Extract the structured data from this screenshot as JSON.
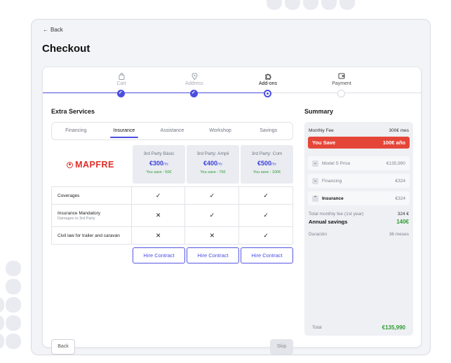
{
  "nav": {
    "back_label": "Back"
  },
  "page": {
    "title": "Checkout"
  },
  "stepper": {
    "steps": [
      {
        "label": "Cart",
        "icon": "cart-icon",
        "state": "done"
      },
      {
        "label": "Address",
        "icon": "map-pin-icon",
        "state": "done"
      },
      {
        "label": "Add-ons",
        "icon": "puzzle-icon",
        "state": "current"
      },
      {
        "label": "Payment",
        "icon": "wallet-icon",
        "state": "todo"
      }
    ]
  },
  "extras": {
    "title": "Extra Services",
    "tabs": [
      "Financing",
      "Insurance",
      "Assistance",
      "Workshop",
      "Savings"
    ],
    "active_tab": "Insurance",
    "provider": "MAPFRE",
    "plans": [
      {
        "name": "3rd Party Básic",
        "price": "€300",
        "per": "/Yr",
        "save": "You save : 50€"
      },
      {
        "name": "3rd Party: Ampli",
        "price": "€400",
        "per": "/Yr",
        "save": "You save : 75€"
      },
      {
        "name": "3rd Party: Com",
        "price": "€500",
        "per": "/Yr",
        "save": "You save : 100€"
      }
    ],
    "coverages": [
      {
        "name": "Coverages",
        "sub": "",
        "marks": [
          "yes",
          "yes",
          "yes"
        ]
      },
      {
        "name": "Insurance Mandatory",
        "sub": "Damages to 3rd Party",
        "marks": [
          "no",
          "yes",
          "yes"
        ]
      },
      {
        "name": "Civil law for trailer and caravan",
        "sub": "",
        "marks": [
          "no",
          "no",
          "yes"
        ]
      }
    ],
    "hire_label": "Hire Contract",
    "back_label": "Back",
    "skip_label": "Skip"
  },
  "summary": {
    "title": "Summary",
    "monthly_fee_label": "Monthly Fee",
    "monthly_fee_value": "300€ mes",
    "you_save_label": "You Save",
    "you_save_value": "100€ año",
    "items": [
      {
        "label": "Model S Price",
        "value": "€135,990"
      },
      {
        "label": "Financing",
        "value": "€324"
      },
      {
        "label": "Insurance",
        "value": "€324"
      }
    ],
    "total_monthly_label": "Total monthly fee (1st year)",
    "total_monthly_value": "324 €",
    "annual_savings_label": "Annual savings",
    "annual_savings_value": "140€",
    "duracion_label": "Duración",
    "duracion_value": "36 meses",
    "total_label": "Total",
    "total_value": "€135,990"
  },
  "colors": {
    "accent": "#4b4ee0",
    "save_red": "#e4473a",
    "success_green": "#2f9a2f",
    "brand_red": "#e02e2a"
  }
}
